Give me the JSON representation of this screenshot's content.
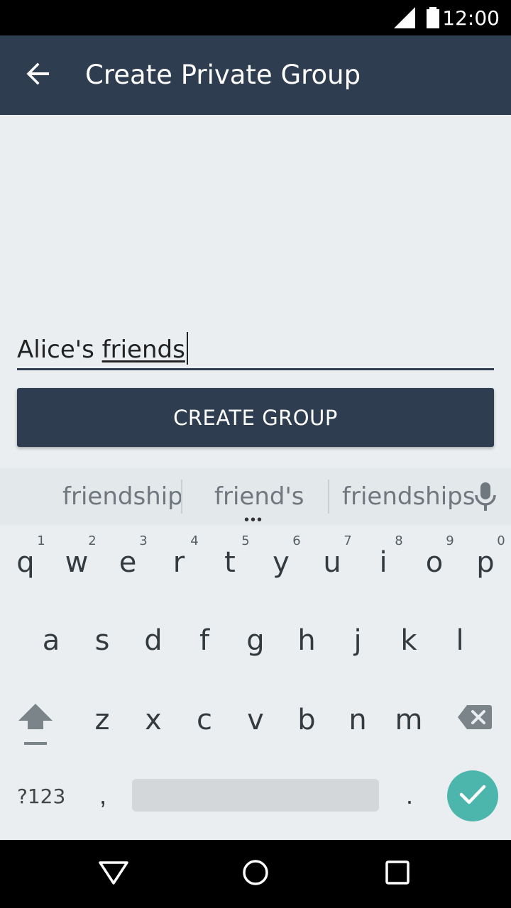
{
  "status_bar": {
    "time": "12:00"
  },
  "app_bar": {
    "title": "Create Private Group"
  },
  "form": {
    "group_name_prefix": "Alice's ",
    "group_name_word": "friends",
    "create_button": "CREATE GROUP"
  },
  "suggestions": [
    "friendship",
    "friend's",
    "friendships"
  ],
  "keyboard": {
    "row1": [
      "q",
      "w",
      "e",
      "r",
      "t",
      "y",
      "u",
      "i",
      "o",
      "p"
    ],
    "row1_hints": [
      "1",
      "2",
      "3",
      "4",
      "5",
      "6",
      "7",
      "8",
      "9",
      "0"
    ],
    "row2": [
      "a",
      "s",
      "d",
      "f",
      "g",
      "h",
      "j",
      "k",
      "l"
    ],
    "row3": [
      "z",
      "x",
      "c",
      "v",
      "b",
      "n",
      "m"
    ],
    "symbols_label": "?123",
    "comma": ",",
    "period": "."
  },
  "colors": {
    "app_bar": "#2e3d50",
    "background": "#eaeef1",
    "accent_enter": "#4db6ac"
  }
}
